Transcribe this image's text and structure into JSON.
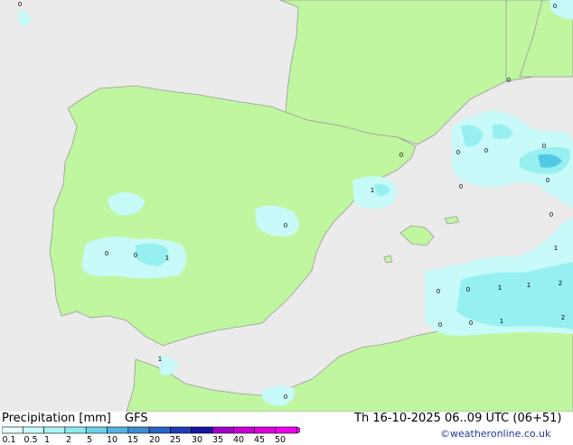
{
  "map": {
    "colors": {
      "sea": "#ebebeb",
      "land": "#c0f6a0",
      "coast": "#999999",
      "precip_light": "#c8fafa",
      "precip_mid": "#96f0f0",
      "precip_heavy": "#50c8e6"
    },
    "value_labels": [
      "0",
      "0",
      "0",
      "1",
      "0",
      "1",
      "0",
      "0",
      "0",
      "0",
      "0",
      "0",
      "0",
      "0",
      "0",
      "1",
      "0",
      "0",
      "1",
      "1",
      "2",
      "0",
      "0",
      "1",
      "2",
      "1",
      "0"
    ]
  },
  "footer": {
    "title": "Precipitation [mm]",
    "model": "GFS",
    "valid_time": "Th 16-10-2025 06..09 UTC (06+51)",
    "credit": "©weatheronline.co.uk",
    "legend": {
      "ticks": [
        "0.1",
        "0.5",
        "1",
        "2",
        "5",
        "10",
        "15",
        "20",
        "25",
        "30",
        "35",
        "40",
        "45",
        "50"
      ],
      "colors": [
        "#e6ffff",
        "#c8fafa",
        "#aaf5f5",
        "#8cebf0",
        "#6ed2eb",
        "#50b4e6",
        "#3c8cd2",
        "#2864c8",
        "#1e3cb4",
        "#1414a0",
        "#a000c8",
        "#c800d2",
        "#dc00dc",
        "#f000f0"
      ]
    }
  }
}
